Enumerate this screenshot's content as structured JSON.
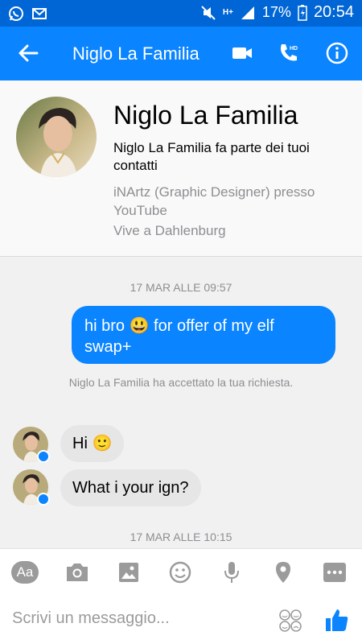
{
  "status_bar": {
    "battery": "17%",
    "time": "20:54",
    "network": "H+"
  },
  "header": {
    "title": "Niglo La Familia"
  },
  "profile": {
    "name": "Niglo La Familia",
    "contact_note": "Niglo La Familia fa parte dei tuoi contatti",
    "work": "iNArtz (Graphic Designer) presso YouTube",
    "location": "Vive a Dahlenburg"
  },
  "chat": {
    "date_1": "17 MAR ALLE 09:57",
    "outgoing_1": "hi bro 😃 for offer of my elf swap+",
    "system_1": "Niglo La Familia ha accettato la tua richiesta.",
    "incoming_1": "Hi 🙂",
    "incoming_2": "What i your ign?",
    "date_2": "17 MAR ALLE 10:15"
  },
  "composer": {
    "aa_label": "Aa",
    "placeholder": "Scrivi un messaggio..."
  },
  "colors": {
    "brand": "#0a84ff",
    "statusbar": "#0066d6",
    "incoming_bubble": "#e6e6e6",
    "icon_gray": "#9b9b9b"
  }
}
